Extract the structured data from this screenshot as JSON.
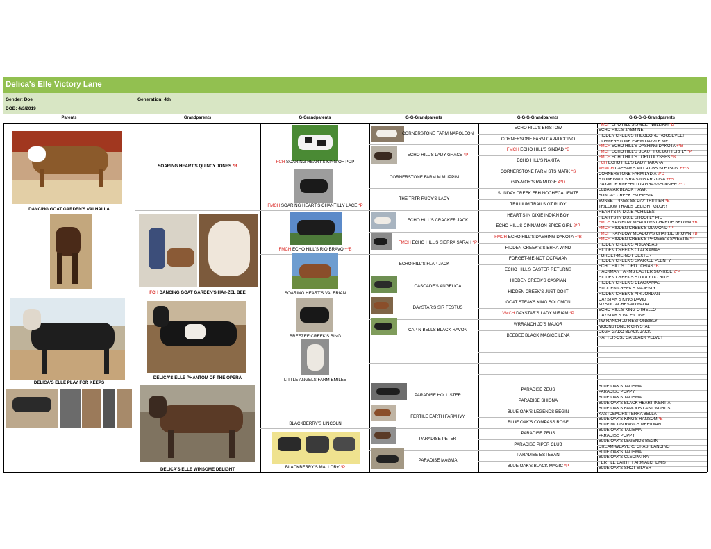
{
  "header": {
    "title": "Delica's Elle Victory Lane",
    "gender": "Gender: Doe",
    "generation": "Generation: 4th",
    "dob": "DOB: 4/3/2019"
  },
  "columns": [
    "Parents",
    "Grandparents",
    "G-Grandparents",
    "G-G-Grandparents",
    "G-G-G-Grandparents",
    "G-G-G-G-Grandparents"
  ],
  "parents": {
    "sire": "DANCING GOAT GARDEN'S VALHALLA",
    "dam": "DELICA'S ELLE PLAY FOR KEEPS"
  },
  "grandparents": {
    "g1_name": "SOARING HEART'S QUINCY JONES",
    "g1_suffix": " *B",
    "g2_prefix": "FCH",
    "g2_name": " DANCING GOAT GARDEN'S HAY-ZEL BEE",
    "g3_name": "DELICA'S ELLE PHANTOM OF THE OPERA",
    "g4_name": "DELICA'S ELLE WINSOME DELIGHT"
  },
  "ggp": [
    {
      "pre": "FCH",
      "name": " SOARING HEART'S KING OF POP",
      "suf": ""
    },
    {
      "pre": "FMCH",
      "name": " SOARING HEART'S CHANTILLY LACE",
      "suf": " *P"
    },
    {
      "pre": "FMCH",
      "name": " ECHO HILL'S RIO BRAVO",
      "suf": " +*B"
    },
    {
      "pre": "",
      "name": "SOARING HEART'S VALERIAN",
      "suf": ""
    },
    {
      "pre": "",
      "name": "BREEZEE CREEK'S BING",
      "suf": ""
    },
    {
      "pre": "",
      "name": "LITTLE ANGELS FARM EMILEE",
      "suf": ""
    },
    {
      "pre": "",
      "name": "BLACKBERRY'S LINCOLN",
      "suf": ""
    },
    {
      "pre": "",
      "name": "BLACKBERRY'S MALLORY",
      "suf": " *P"
    }
  ],
  "g3": [
    {
      "pre": "",
      "name": "CORNERSTONE FARM NAPOLEON",
      "suf": ""
    },
    {
      "pre": "",
      "name": "ECHO HILL'S LADY GRACE",
      "suf": " *P"
    },
    {
      "pre": "",
      "name": "CORNERSTONE FARM M MUPPIM",
      "suf": ""
    },
    {
      "pre": "",
      "name": "THE TRTR RUDY'S LACY",
      "suf": ""
    },
    {
      "pre": "",
      "name": "ECHO HILL'S CRACKER JACK",
      "suf": ""
    },
    {
      "pre": "FMCH",
      "name": " ECHO HILL'S SIERRA SARAH",
      "suf": " *P"
    },
    {
      "pre": "",
      "name": "ECHO HILL'S FLAP JACK",
      "suf": ""
    },
    {
      "pre": "",
      "name": "CASCADE'S ANGELICA",
      "suf": ""
    },
    {
      "pre": "",
      "name": "DAYSTAR'S SIR FESTUS",
      "suf": ""
    },
    {
      "pre": "",
      "name": "CAP N BELLS BLACK RAVON",
      "suf": ""
    },
    {
      "pre": "",
      "name": "",
      "suf": ""
    },
    {
      "pre": "",
      "name": "",
      "suf": ""
    },
    {
      "pre": "",
      "name": "PARADISE HOLLISTER",
      "suf": ""
    },
    {
      "pre": "",
      "name": "FERTILE EARTH FARM IVY",
      "suf": ""
    },
    {
      "pre": "",
      "name": "PARADISE PETER",
      "suf": ""
    },
    {
      "pre": "",
      "name": "PARADISE MAGMA",
      "suf": ""
    }
  ],
  "g4": [
    {
      "pre": "",
      "name": "ECHO HILL'S BRISTOW",
      "suf": ""
    },
    {
      "pre": "",
      "name": "CORNERSONE FARM CAPPUCCINO",
      "suf": ""
    },
    {
      "pre": "FMCH",
      "name": " ECHO HILL'S SINBAD",
      "suf": " *B"
    },
    {
      "pre": "",
      "name": "ECHO HILL'S NAKITA",
      "suf": ""
    },
    {
      "pre": "",
      "name": "CORNERSTONE FARM STS MARK",
      "suf": " *S"
    },
    {
      "pre": "",
      "name": "GAY-MOR'S RA MIDGE",
      "suf": " 4*D"
    },
    {
      "pre": "",
      "name": "SUNDAY CREEK FBH NOCHECALIENTE",
      "suf": ""
    },
    {
      "pre": "",
      "name": "TRILLIUM TRAILS GT RUDY",
      "suf": ""
    },
    {
      "pre": "",
      "name": "HEART'S IN DIXIE INDIAN BOY",
      "suf": ""
    },
    {
      "pre": "",
      "name": "ECHO HILL'S CINNAMON SPICE GIRL",
      "suf": " 2*P"
    },
    {
      "pre": "FMCH",
      "name": " ECHO HILL'S DASHING DAKOTA",
      "suf": " +*B"
    },
    {
      "pre": "",
      "name": "HIDDEN CREEK'S SIERRA WIND",
      "suf": ""
    },
    {
      "pre": "",
      "name": "FORGET-ME-NOT OCTAVIAN",
      "suf": ""
    },
    {
      "pre": "",
      "name": "ECHO HILL'S EASTER RETURNS",
      "suf": ""
    },
    {
      "pre": "",
      "name": "HIDDEN CREEK'S CASPIAN",
      "suf": ""
    },
    {
      "pre": "",
      "name": "HIDDEN CREEK'S JUST DO IT",
      "suf": ""
    },
    {
      "pre": "",
      "name": "GOAT STEAKS KING SOLOMON",
      "suf": ""
    },
    {
      "pre": "VMCH",
      "name": " DAYSTAR'S LADY MIRIAM",
      "suf": " *P"
    },
    {
      "pre": "",
      "name": "WRRANCH JD'S MAJOR",
      "suf": ""
    },
    {
      "pre": "",
      "name": "BEEBEE BLACK MAGICE LENA",
      "suf": ""
    },
    {
      "pre": "",
      "name": "",
      "suf": ""
    },
    {
      "pre": "",
      "name": "",
      "suf": ""
    },
    {
      "pre": "",
      "name": "",
      "suf": ""
    },
    {
      "pre": "",
      "name": "",
      "suf": ""
    },
    {
      "pre": "",
      "name": "PARADISE ZEUS",
      "suf": ""
    },
    {
      "pre": "",
      "name": "PARADISE SHIONA",
      "suf": ""
    },
    {
      "pre": "",
      "name": "BLUE OAK'S LEGENDS BEGIN",
      "suf": ""
    },
    {
      "pre": "",
      "name": "BLUE OAK'S COMPASS ROSE",
      "suf": ""
    },
    {
      "pre": "",
      "name": "PARADISE ZEUS",
      "suf": ""
    },
    {
      "pre": "",
      "name": "PARADISE PIPER CLUB",
      "suf": ""
    },
    {
      "pre": "",
      "name": "PARADISE ESTEBAN",
      "suf": ""
    },
    {
      "pre": "",
      "name": "BLUE OAK'S BLACK MAGIC",
      "suf": " *P"
    }
  ],
  "g5": [
    {
      "pre": "FMCH",
      "name": " EHO HILL'S SWEET WILLIAM",
      "suf": " *B"
    },
    {
      "pre": "",
      "name": "ECHO HILL'S JASMINE",
      "suf": ""
    },
    {
      "pre": "",
      "name": "HIDDEN CREEK'S THEODORE ROOSEVELT",
      "suf": ""
    },
    {
      "pre": "",
      "name": "CORNERSTONE FARM DAZZLE ME",
      "suf": ""
    },
    {
      "pre": "FMCH",
      "name": " ECHO HILL'S DASHING DAKOTA",
      "suf": " +*B"
    },
    {
      "pre": "FMCH",
      "name": " ECHO HILL'S BEAUTIFUL BUTTERFLY",
      "suf": " *P"
    },
    {
      "pre": "FMCH",
      "name": " ECHO HILL'S LORD ULYSSES",
      "suf": " *B"
    },
    {
      "pre": "FCH",
      "name": " ECHO HILL'S LADY TAKARA",
      "suf": ""
    },
    {
      "pre": "ARMCH",
      "name": " CAESAR'S VILLA CBS STETSON",
      "suf": " ++*S"
    },
    {
      "pre": "",
      "name": "CORNERSTONE FARM LYDIA",
      "suf": " 2*D"
    },
    {
      "pre": "",
      "name": "STONEWALL'S RAISING ARIZONA",
      "suf": " ++S"
    },
    {
      "pre": "",
      "name": "GAY-MOR KNEEHI TOA GRASSHOPPER",
      "suf": " 3*D"
    },
    {
      "pre": "",
      "name": "ELDAMAR BLACK HAWK",
      "suf": ""
    },
    {
      "pre": "",
      "name": "SUNDAY CREEK FM FIESTA",
      "suf": ""
    },
    {
      "pre": "",
      "name": "SUNSET PINES SS DAY TRIPPER",
      "suf": " *B"
    },
    {
      "pre": "",
      "name": "TRILLIUM TRAILS DELIGHT GLORY",
      "suf": ""
    },
    {
      "pre": "",
      "name": "HEART'S IN DIXIE ACHILLES",
      "suf": ""
    },
    {
      "pre": "",
      "name": "HEART'S IN DIXIE SHOOFLY PIE",
      "suf": ""
    },
    {
      "pre": "FMCH",
      "name": " RAINBOW MEADOWS CHARLIE BROWN",
      "suf": " +B"
    },
    {
      "pre": "FMCH",
      "name": " HIDDEN CREEK'S DIAMOND",
      "suf": " *P"
    },
    {
      "pre": "FMCH",
      "name": " RAINBOW MEADOWS CHARLIE BROWN",
      "suf": " +B"
    },
    {
      "pre": "FMCH",
      "name": " HIDDEN CREEK'S PHOEBE'S SWEETIE",
      "suf": " *P"
    },
    {
      "pre": "",
      "name": "HIDDEN CREEK'S ARKANSAS",
      "suf": ""
    },
    {
      "pre": "",
      "name": "HIDDEN CREEK'S CLACKAMAS",
      "suf": ""
    },
    {
      "pre": "",
      "name": "FORGET-ME-NOT DEXTER",
      "suf": ""
    },
    {
      "pre": "",
      "name": "HIDDEN CREEK'S SPARKLE PLENTY",
      "suf": ""
    },
    {
      "pre": "",
      "name": "ECHO HILL'S LORD TOBIAS",
      "suf": " *B"
    },
    {
      "pre": "",
      "name": "HACKMAN FARMS EASTER SUNRISE",
      "suf": " 2*P"
    },
    {
      "pre": "",
      "name": "HIDDEN CREEK'S STUDLY DO RITE",
      "suf": ""
    },
    {
      "pre": "",
      "name": "HIDDEN CREEK'S CLACKAMAS",
      "suf": ""
    },
    {
      "pre": "",
      "name": "HUDDEN CREEK'S MAJESTY",
      "suf": ""
    },
    {
      "pre": "",
      "name": "HIDDEN CREEK'S AIR JORDAN",
      "suf": ""
    },
    {
      "pre": "",
      "name": "DAYSTAR'S KING DAVID",
      "suf": ""
    },
    {
      "pre": "",
      "name": "MYSTIC ACRES ADWAITA",
      "suf": ""
    },
    {
      "pre": "",
      "name": "ECHO HILL'S KING OTHELLO",
      "suf": ""
    },
    {
      "pre": "",
      "name": "DAYSTAR'S VALENTINE",
      "suf": ""
    },
    {
      "pre": "",
      "name": "TW RANCH JD RESPONSIBLY",
      "suf": ""
    },
    {
      "pre": "",
      "name": "MOONSTONE R CRYSTAL",
      "suf": ""
    },
    {
      "pre": "",
      "name": "DKGH GADO BLACK JACK",
      "suf": ""
    },
    {
      "pre": "",
      "name": "RAFTER-CSJ GA BLACK VELVET",
      "suf": ""
    },
    {
      "pre": "",
      "name": "",
      "suf": ""
    },
    {
      "pre": "",
      "name": "",
      "suf": ""
    },
    {
      "pre": "",
      "name": "",
      "suf": ""
    },
    {
      "pre": "",
      "name": "",
      "suf": ""
    },
    {
      "pre": "",
      "name": "",
      "suf": ""
    },
    {
      "pre": "",
      "name": "",
      "suf": ""
    },
    {
      "pre": "",
      "name": "",
      "suf": ""
    },
    {
      "pre": "",
      "name": "",
      "suf": ""
    },
    {
      "pre": "",
      "name": "BLUE OAK'S TALISMA",
      "suf": ""
    },
    {
      "pre": "",
      "name": "PARADISE POPPY",
      "suf": ""
    },
    {
      "pre": "",
      "name": "BLUE OAK'S TALISMA",
      "suf": ""
    },
    {
      "pre": "",
      "name": "BLUE OAK'S BLACK HEART INERTIA",
      "suf": ""
    },
    {
      "pre": "",
      "name": "BLUE OAK'S FAMOUS LAST WORDS",
      "suf": ""
    },
    {
      "pre": "",
      "name": "KASTDEMURS TERRA BELLA",
      "suf": ""
    },
    {
      "pre": "",
      "name": "BLUE OAK'S KING'S RANSOM",
      "suf": " *B"
    },
    {
      "pre": "",
      "name": "BLUE MOON RANCH MERIDIAN",
      "suf": ""
    },
    {
      "pre": "",
      "name": "BLUE OAK'S TALISMA",
      "suf": ""
    },
    {
      "pre": "",
      "name": "PARADISE POPPY",
      "suf": ""
    },
    {
      "pre": "",
      "name": "BLUE OAK'S LEGENDS BEGIN",
      "suf": ""
    },
    {
      "pre": "",
      "name": "DREAM-WEAVERS CRASHLANDING",
      "suf": ""
    },
    {
      "pre": "",
      "name": "BLUE OAK'S TALISMA",
      "suf": ""
    },
    {
      "pre": "",
      "name": "BLUE OAK'S CLEOPATRA",
      "suf": ""
    },
    {
      "pre": "",
      "name": "FERTILE EARTH FARM ALCHEMIST",
      "suf": ""
    },
    {
      "pre": "",
      "name": "BLUE OAK'S SHOT SILVER",
      "suf": ""
    }
  ],
  "colors": {
    "title_bar": "#92c050",
    "info_bar": "#d8e6c4",
    "title_red": "#d9231f"
  },
  "photo_subjects": [
    "goat-photo"
  ]
}
